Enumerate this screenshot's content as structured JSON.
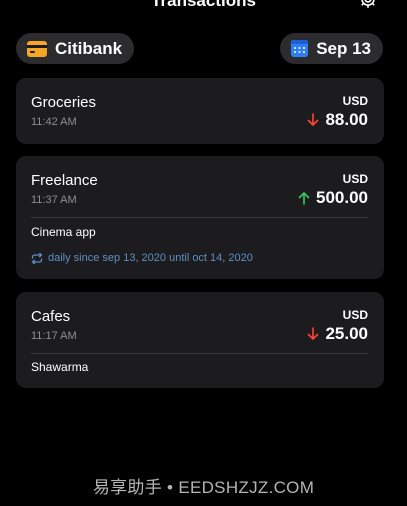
{
  "header": {
    "title": "Transactions",
    "settings_icon": "gear-icon"
  },
  "filters": {
    "account": {
      "label": "Citibank",
      "icon": "credit-card-icon",
      "icon_color": "#f5a623"
    },
    "date": {
      "label": "Sep 13",
      "icon": "calendar-icon",
      "icon_color": "#2f7ef6"
    }
  },
  "colors": {
    "expense_arrow": "#ff453a",
    "income_arrow": "#30d158",
    "recurrence_text": "#5f8fc4"
  },
  "transactions": [
    {
      "name": "Groceries",
      "time": "11:42 AM",
      "currency": "USD",
      "amount": "88.00",
      "direction": "down"
    },
    {
      "name": "Freelance",
      "time": "11:37 AM",
      "currency": "USD",
      "amount": "500.00",
      "direction": "up",
      "note": "Cinema app",
      "recurrence": "daily since sep 13, 2020 until oct 14, 2020"
    },
    {
      "name": "Cafes",
      "time": "11:17 AM",
      "currency": "USD",
      "amount": "25.00",
      "direction": "down",
      "note": "Shawarma"
    }
  ],
  "watermark": "易享助手 • EEDSHZJZ.COM"
}
